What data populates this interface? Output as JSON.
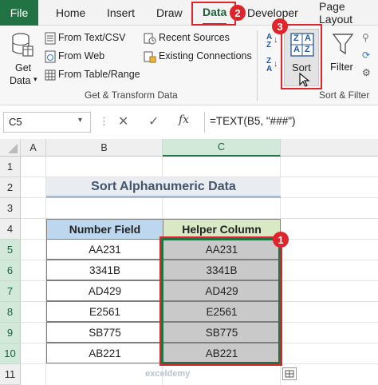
{
  "tabs": {
    "file": "File",
    "home": "Home",
    "insert": "Insert",
    "draw": "Draw",
    "data": "Data",
    "developer": "Developer",
    "page_layout": "Page Layout"
  },
  "ribbon": {
    "get_data": "Get",
    "get_data_2": "Data",
    "from_text_csv": "From Text/CSV",
    "from_web": "From Web",
    "from_table_range": "From Table/Range",
    "recent_sources": "Recent Sources",
    "existing_connections": "Existing Connections",
    "group_get_transform": "Get & Transform Data",
    "sort": "Sort",
    "filter": "Filter",
    "group_sort_filter": "Sort & Filter",
    "sort_icon_top": "Z",
    "sort_icon_mid": "A",
    "az_a": "A",
    "az_z": "Z"
  },
  "badges": {
    "data_tab": "2",
    "sort_button": "3",
    "data_range": "1"
  },
  "formula_bar": {
    "name_box": "C5",
    "dots": "⋮",
    "cancel": "✕",
    "enter": "✓",
    "fx": "fx",
    "formula": "=TEXT(B5, \"###\")"
  },
  "columns": [
    "A",
    "B",
    "C"
  ],
  "rows": [
    "1",
    "2",
    "3",
    "4",
    "5",
    "6",
    "7",
    "8",
    "9",
    "10",
    "11"
  ],
  "sheet": {
    "title": "Sort Alphanumeric Data",
    "headers": [
      "Number Field",
      "Helper Column"
    ],
    "data": [
      [
        "AA231",
        "AA231"
      ],
      [
        "3341B",
        "3341B"
      ],
      [
        "AD429",
        "AD429"
      ],
      [
        "E2561",
        "E2561"
      ],
      [
        "SB775",
        "SB775"
      ],
      [
        "AB221",
        "AB221"
      ]
    ]
  },
  "watermark": "exceldemy",
  "colors": {
    "excel_green": "#217346",
    "highlight_red": "#e0242c"
  }
}
